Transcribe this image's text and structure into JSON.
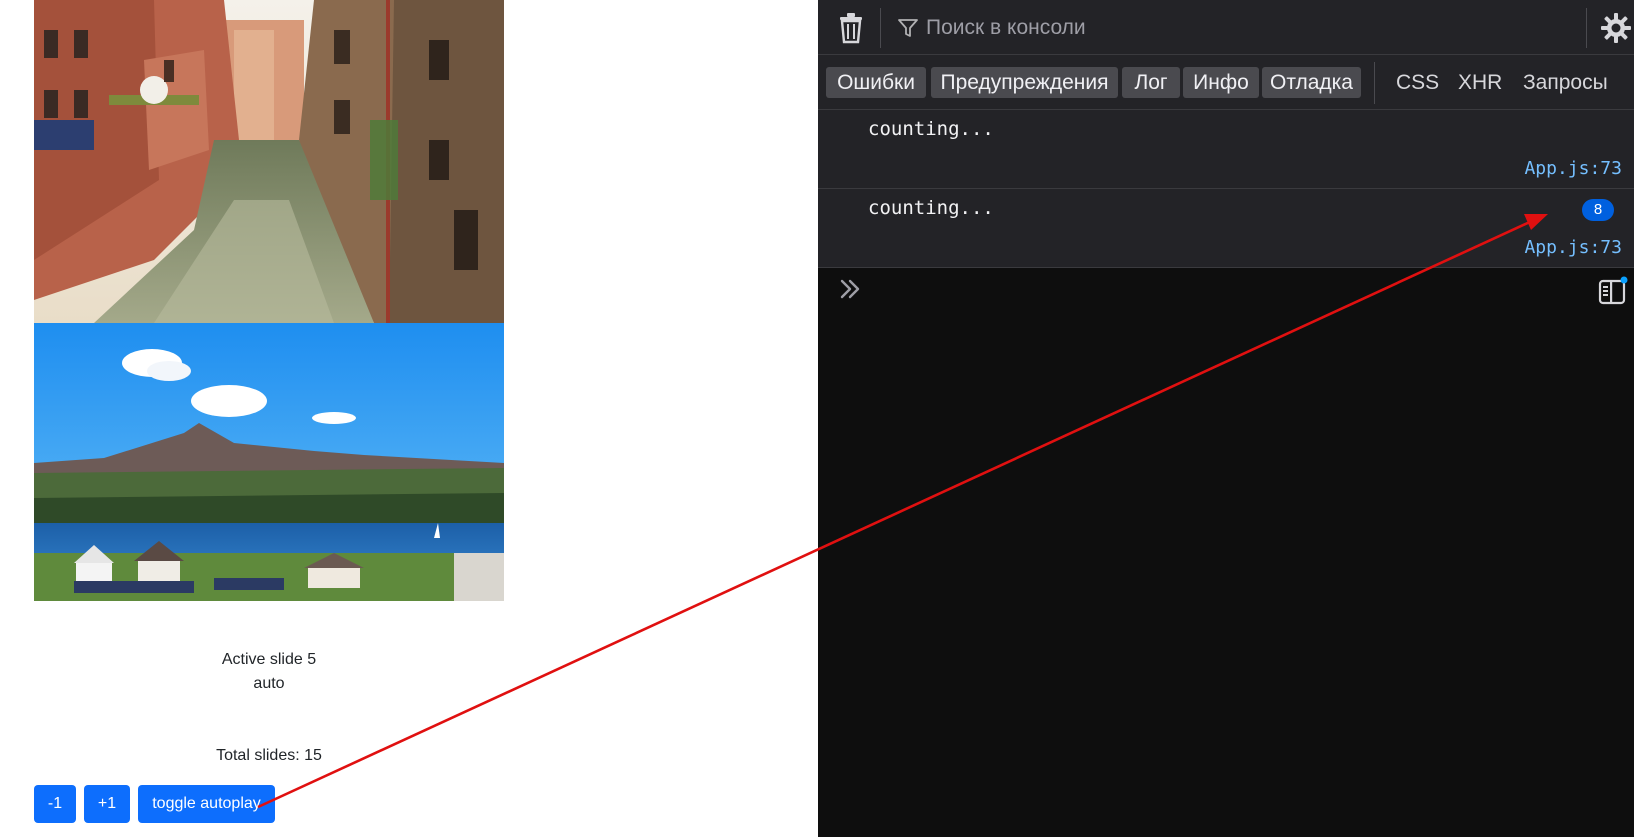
{
  "page": {
    "active_slide_label": "Active slide 5",
    "mode_label": "auto",
    "total_slides_label": "Total slides: 15",
    "buttons": {
      "prev": "-1",
      "next": "+1",
      "toggle": "toggle autoplay"
    },
    "button_color": "#0d6efd"
  },
  "devtools": {
    "filter_placeholder": "Поиск в консоли",
    "filter_buttons": [
      "Ошибки",
      "Предупреждения",
      "Лог",
      "Инфо",
      "Отладка"
    ],
    "filter_links": [
      "CSS",
      "XHR",
      "Запросы"
    ],
    "messages": [
      {
        "text": "counting...",
        "source": "App.js:73"
      },
      {
        "text": "counting...",
        "source": "App.js:73",
        "repeat_count": "8"
      }
    ],
    "icons": [
      "trash-icon",
      "filter-icon",
      "gear-icon",
      "prompt-chevron-icon",
      "split-console-icon"
    ],
    "accent_color": "#75bfff",
    "badge_color": "#0060df"
  },
  "annotation": {
    "arrow_color": "#e01010"
  }
}
